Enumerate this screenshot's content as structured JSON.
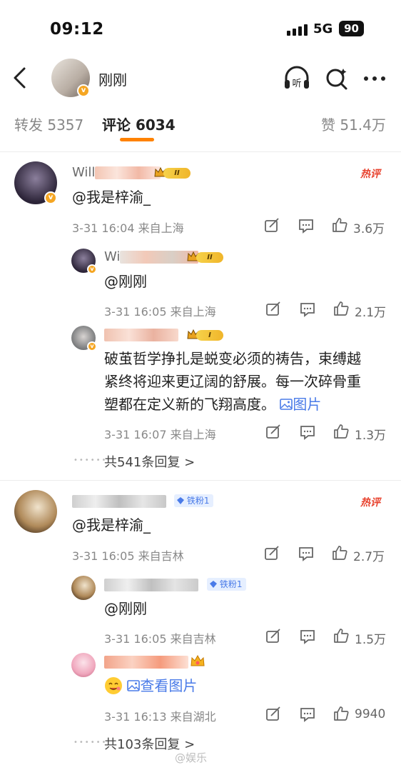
{
  "status_bar": {
    "time": "09:12",
    "network": "5G",
    "battery": "90"
  },
  "header": {
    "username": "刚刚",
    "verified_badge": "v",
    "listen_label": "听"
  },
  "tabs": [
    {
      "label": "转发",
      "count": "5357"
    },
    {
      "label": "评论",
      "count": "6034"
    },
    {
      "label": "赞",
      "count": "51.4万"
    }
  ],
  "threads": [
    {
      "hot_label": "热评",
      "comment": {
        "name": "Will",
        "level": "II",
        "text": "@我是梓渝_",
        "date": "3-31 16:04",
        "location": "来自上海",
        "likes": "3.6万"
      },
      "replies": [
        {
          "name": "Wi",
          "level": "II",
          "text": "@刚刚",
          "date": "3-31 16:05",
          "location": "来自上海",
          "likes": "2.1万"
        },
        {
          "name": "",
          "level": "I",
          "text_lines": [
            "破茧哲学挣扎是蜕变必须的祷告，束缚越",
            "紧终将迎来更辽阔的舒展。每一次碎骨重",
            "塑都在定义新的飞翔高度。"
          ],
          "image_link": "图片",
          "date": "3-31 16:07",
          "location": "来自上海",
          "likes": "1.3万"
        }
      ],
      "more_replies": "共541条回复 >"
    },
    {
      "hot_label": "热评",
      "comment": {
        "name": "",
        "fan_badge": "铁粉1",
        "text": "@我是梓渝_",
        "date": "3-31 16:05",
        "location": "来自吉林",
        "likes": "2.7万"
      },
      "replies": [
        {
          "name": "",
          "fan_badge": "铁粉1",
          "text": "@刚刚",
          "date": "3-31 16:05",
          "location": "来自吉林",
          "likes": "1.5万"
        },
        {
          "name": "",
          "image_link": "查看图片",
          "date": "3-31 16:13",
          "location": "来自湖北",
          "likes": "9940"
        }
      ],
      "more_replies": "共103条回复 >"
    }
  ],
  "watermark": "@娱乐",
  "colors": {
    "accent": "#ff8200",
    "link": "#4a7be8",
    "hot": "#e8432f",
    "verified": "#f5a623"
  }
}
